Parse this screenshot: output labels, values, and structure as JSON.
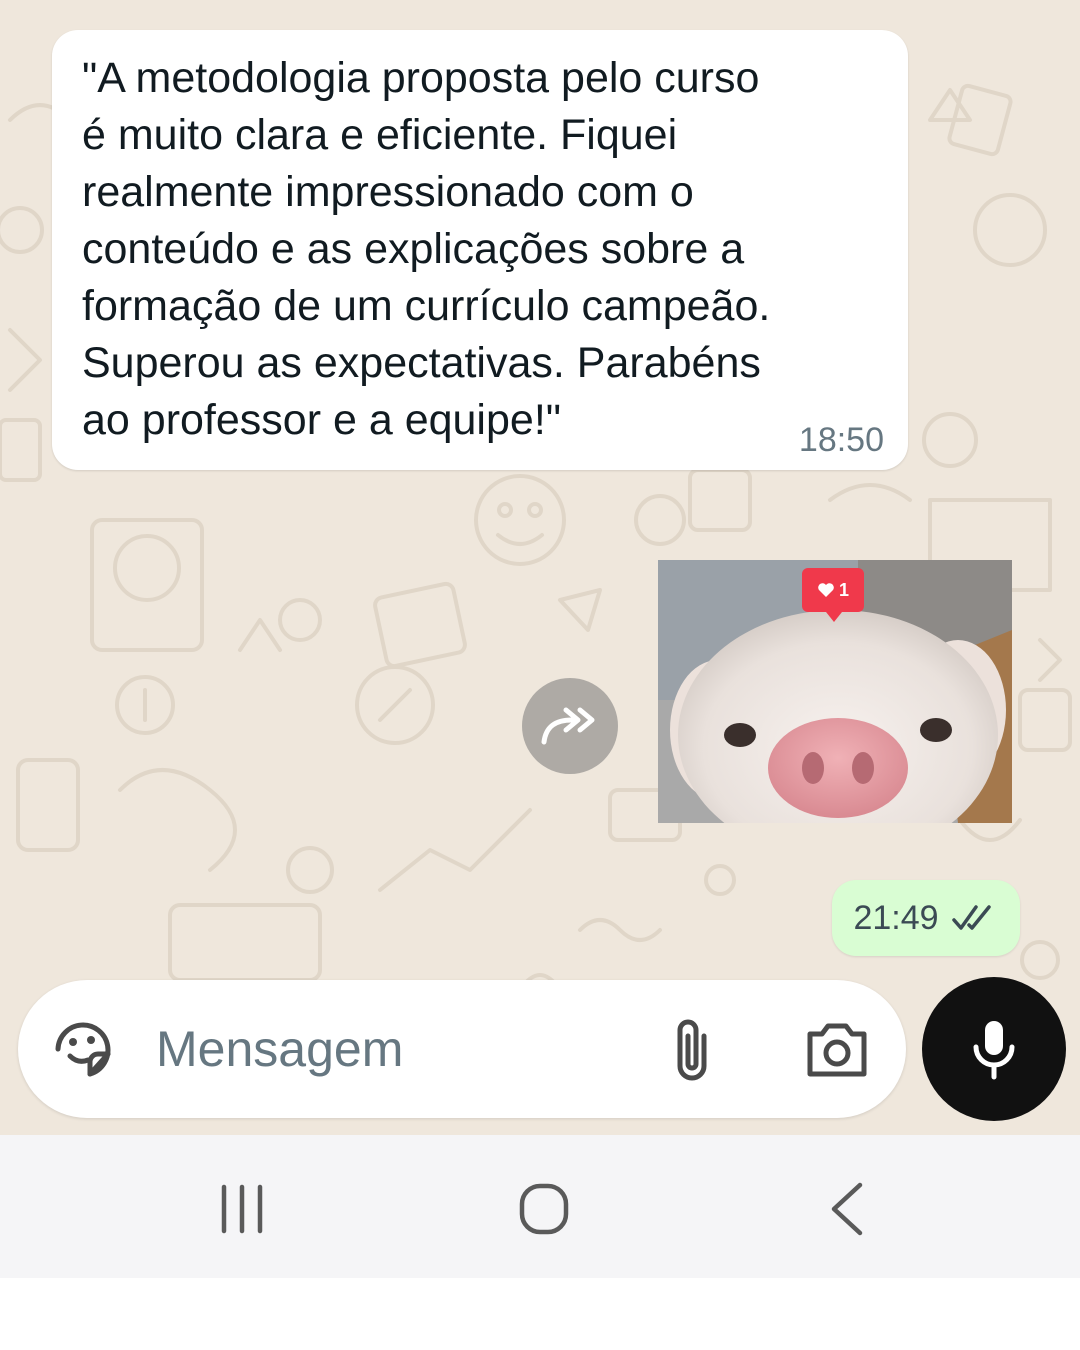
{
  "chat": {
    "incoming_message": {
      "text": "\"A metodologia proposta pelo curso\né muito clara e eficiente. Fiquei\nrealmente impressionado com o\nconteúdo e as explicações sobre a\nformação de um currículo campeão.\nSuperou as expectativas. Parabéns\nao professor e a equipe!\"",
      "time": "18:50"
    },
    "image_message": {
      "like_count": "1",
      "like_icon": "heart-icon"
    },
    "forward_icon": "forward-icon",
    "outgoing_message": {
      "time": "21:49",
      "status_icon": "double-check-icon"
    }
  },
  "composer": {
    "placeholder": "Mensagem",
    "sticker_icon": "sticker-icon",
    "attach_icon": "paperclip-icon",
    "camera_icon": "camera-icon",
    "mic_icon": "microphone-icon"
  },
  "nav_bar": {
    "recents_icon": "recents-icon",
    "home_icon": "home-icon",
    "back_icon": "back-icon"
  },
  "colors": {
    "chat_background": "#efe7dc",
    "outgoing_bubble": "#d9fdd3",
    "incoming_bubble": "#ffffff",
    "mic_button": "#111111",
    "like_badge": "#f0394b"
  }
}
